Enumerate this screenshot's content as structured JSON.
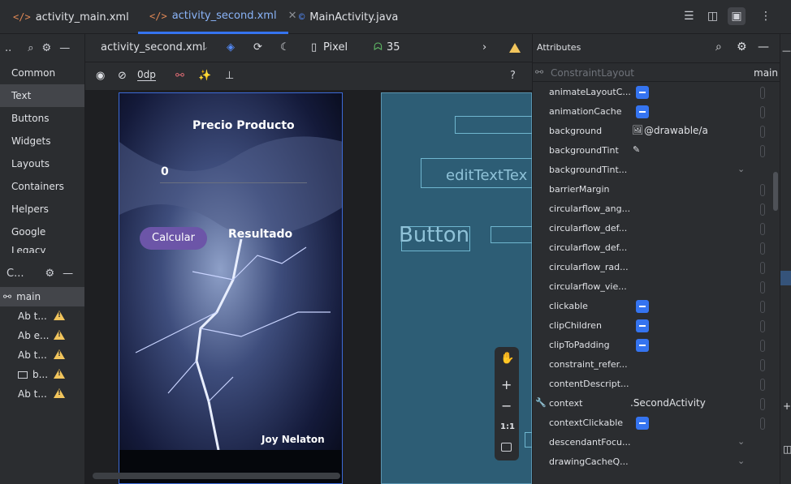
{
  "tabs": [
    {
      "icon": "</>",
      "label": "activity_main.xml",
      "active": false
    },
    {
      "icon": "</>",
      "label": "activity_second.xml",
      "active": true
    },
    {
      "icon": "©",
      "label": "MainActivity.java",
      "active": false
    }
  ],
  "toolbar": {
    "file": "activity_second.xml",
    "device": "Pixel",
    "api": "35",
    "margin": "0dp",
    "help": "?"
  },
  "palette": {
    "categories": [
      "Common",
      "Text",
      "Buttons",
      "Widgets",
      "Layouts",
      "Containers",
      "Helpers",
      "Google",
      "Legacy"
    ],
    "selected": "Text"
  },
  "tree": {
    "header": "C...",
    "root": "main",
    "items": [
      "Ab t...",
      "Ab e...",
      "Ab t...",
      "b...",
      "Ab t..."
    ]
  },
  "design": {
    "title": "Precio Producto",
    "input_value": "0",
    "button": "Calcular",
    "result": "Resultado",
    "author": "Joy Nelaton"
  },
  "blueprint": {
    "edit_text": "editTextTex",
    "button": "Button"
  },
  "zoom": {
    "ratio": "1:1"
  },
  "attributes": {
    "title": "Attributes",
    "layout": "ConstraintLayout",
    "id": "main",
    "rows": [
      {
        "name": "animateLayoutC...",
        "type": "checkbox"
      },
      {
        "name": "animationCache",
        "type": "checkbox"
      },
      {
        "name": "background",
        "type": "value",
        "value": "@drawable/a"
      },
      {
        "name": "backgroundTint",
        "type": "picker"
      },
      {
        "name": "backgroundTint...",
        "type": "dropdown"
      },
      {
        "name": "barrierMargin",
        "type": "empty"
      },
      {
        "name": "circularflow_ang...",
        "type": "empty"
      },
      {
        "name": "circularflow_def...",
        "type": "empty"
      },
      {
        "name": "circularflow_def...",
        "type": "empty"
      },
      {
        "name": "circularflow_rad...",
        "type": "empty"
      },
      {
        "name": "circularflow_vie...",
        "type": "empty"
      },
      {
        "name": "clickable",
        "type": "checkbox"
      },
      {
        "name": "clipChildren",
        "type": "checkbox"
      },
      {
        "name": "clipToPadding",
        "type": "checkbox"
      },
      {
        "name": "constraint_refer...",
        "type": "empty"
      },
      {
        "name": "contentDescript...",
        "type": "empty"
      },
      {
        "name": "context",
        "type": "value",
        "value": ".SecondActivity"
      },
      {
        "name": "contextClickable",
        "type": "checkbox"
      },
      {
        "name": "descendantFocu...",
        "type": "dropdown"
      },
      {
        "name": "drawingCacheQ...",
        "type": "dropdown"
      }
    ]
  }
}
